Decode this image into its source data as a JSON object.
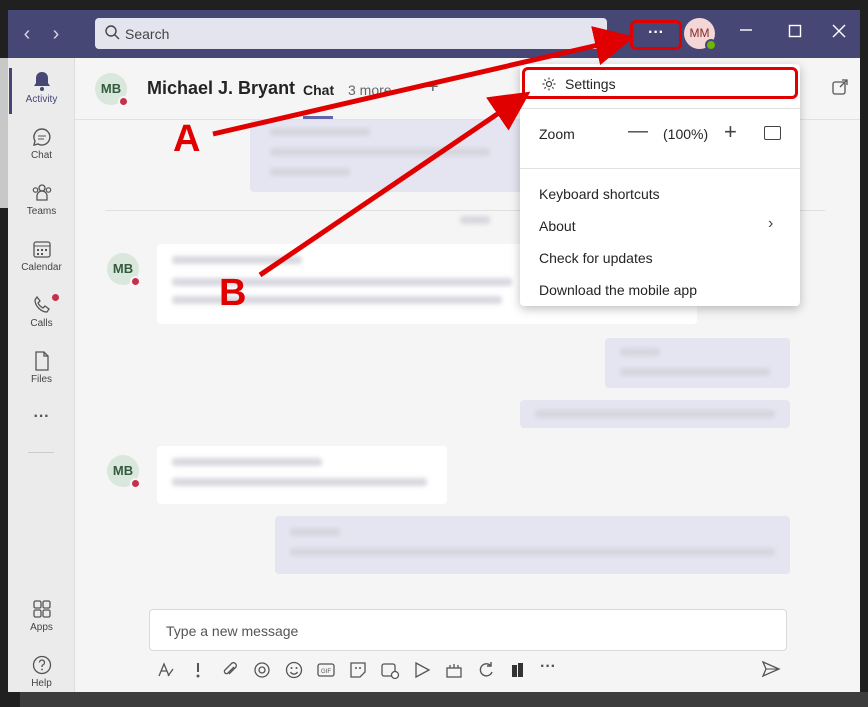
{
  "search": {
    "placeholder": "Search"
  },
  "titlebar": {
    "more_label": "···",
    "user_initials": "MM"
  },
  "rail": {
    "items": [
      {
        "label": "Activity",
        "icon": "bell-icon"
      },
      {
        "label": "Chat",
        "icon": "chat-icon"
      },
      {
        "label": "Teams",
        "icon": "teams-icon"
      },
      {
        "label": "Calendar",
        "icon": "calendar-icon"
      },
      {
        "label": "Calls",
        "icon": "phone-icon"
      },
      {
        "label": "Files",
        "icon": "file-icon"
      },
      {
        "label": "···",
        "icon": "more-icon"
      },
      {
        "label": "Apps",
        "icon": "apps-icon"
      },
      {
        "label": "Help",
        "icon": "help-icon"
      }
    ]
  },
  "chat": {
    "contact_initials": "MB",
    "contact_name": "Michael J. Bryant",
    "tab_chat": "Chat",
    "tab_more": "3 more",
    "add_tab": "+"
  },
  "menu": {
    "settings": "Settings",
    "zoom_label": "Zoom",
    "zoom_minus": "—",
    "zoom_value": "(100%)",
    "zoom_plus": "+",
    "keyboard_shortcuts": "Keyboard shortcuts",
    "about": "About",
    "about_chevron": "›",
    "check_updates": "Check for updates",
    "download_mobile": "Download the mobile app"
  },
  "composer": {
    "placeholder": "Type a new message"
  },
  "annotations": {
    "a": "A",
    "b": "B"
  },
  "colors": {
    "titlebar": "#464775",
    "accent": "#6264a7",
    "annotation": "#e00000",
    "presence_busy": "#c4314b",
    "presence_available": "#6bb700"
  }
}
